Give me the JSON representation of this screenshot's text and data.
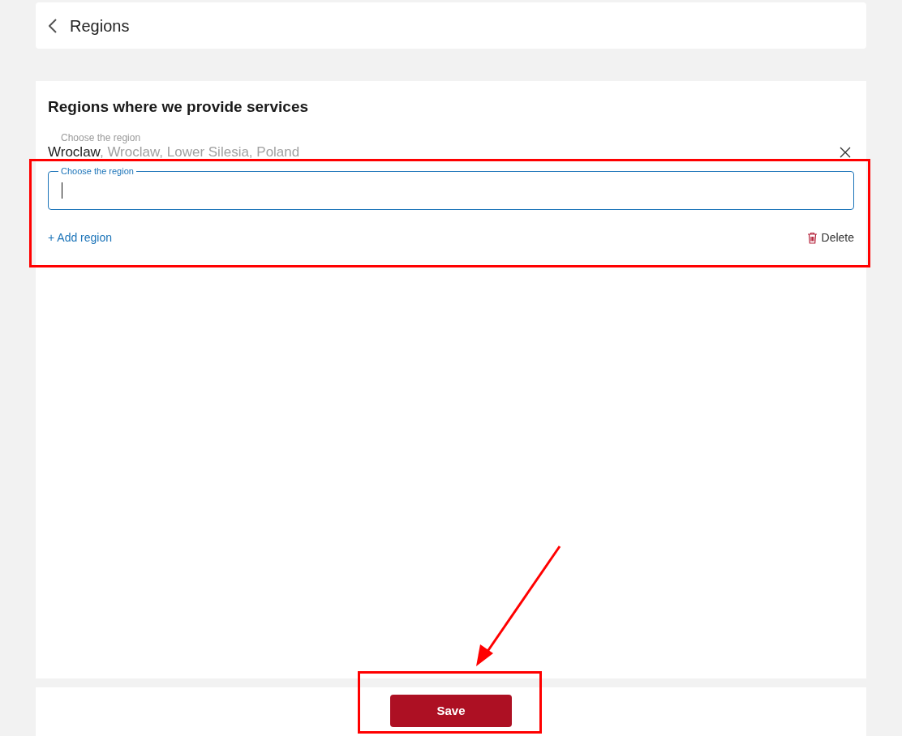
{
  "header": {
    "title": "Regions"
  },
  "section": {
    "title": "Regions where we provide services",
    "regions": [
      {
        "label": "Choose the region",
        "value": "Wroclaw",
        "detail": ", Wroclaw, Lower Silesia, Poland",
        "focused": false
      },
      {
        "label": "Choose the region",
        "focused": true
      }
    ],
    "add_link": "+ Add region",
    "delete_button": "Delete"
  },
  "footer": {
    "save_button": "Save"
  }
}
